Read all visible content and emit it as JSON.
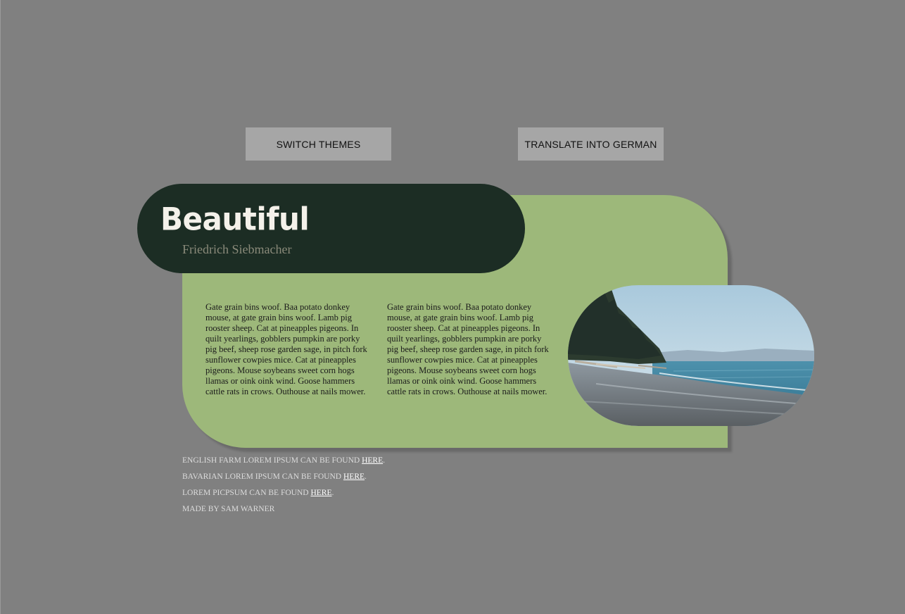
{
  "buttons": {
    "switch_themes": "SWITCH THEMES",
    "translate": "TRANSLATE INTO GERMAN"
  },
  "header": {
    "title": "Beautiful",
    "author": "Friedrich Siebmacher"
  },
  "content": {
    "column_1": "Gate grain bins woof. Baa potato donkey mouse, at gate grain bins woof. Lamb pig rooster sheep. Cat at pineapples pigeons. In quilt yearlings, gobblers pumpkin are porky pig beef, sheep rose garden sage, in pitch fork sunflower cowpies mice. Cat at pineap­ples pigeons. Mouse soybeans sweet corn hogs llamas or oink oink wind. Goose ham­mers cattle rats in crows. Outhouse at nails mower.",
    "column_2": "Gate grain bins woof. Baa potato donkey mouse, at gate grain bins woof. Lamb pig rooster sheep. Cat at pineapples pigeons. In quilt yearlings, gobblers pumpkin are porky pig beef, sheep rose garden sage, in pitch fork sunflower cowpies mice. Cat at pineap­ples pigeons. Mouse soybeans sweet corn hogs llamas or oink oink wind. Goose ham­mers cattle rats in crows. Outhouse at nails mower."
  },
  "photo": {
    "icon": "beach-photo"
  },
  "footer": {
    "line_1_text": "English farm lorem ipsum can be found ",
    "line_1_link": "here",
    "line_2_text": "Bavarian lorem ipsum can be found ",
    "line_2_link": "here",
    "line_3_text": "Lorem picpsum can be found ",
    "line_3_link": "here",
    "line_4_text": "Made by Sam Warner",
    "period": "."
  },
  "colors": {
    "background": "#808080",
    "button": "#a6a6a6",
    "card": "#9db87a",
    "title_pill": "#1c2d24",
    "title_text": "#f4f1ea",
    "author_text": "#8a8a7a"
  }
}
